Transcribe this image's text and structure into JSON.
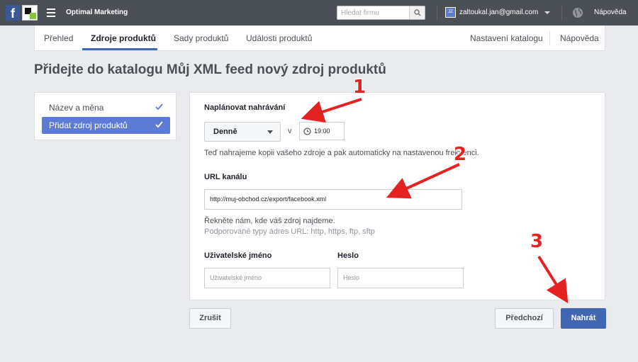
{
  "topbar": {
    "app_name": "Optimal Marketing",
    "search_placeholder": "Hledat firmu",
    "avatar_initials": "JZ",
    "user_email": "zaltoukal.jan@gmail.com",
    "help": "Nápověda"
  },
  "tabs": {
    "items": [
      {
        "label": "Přehled"
      },
      {
        "label": "Zdroje produktů"
      },
      {
        "label": "Sady produktů"
      },
      {
        "label": "Události produktů"
      }
    ],
    "active_index": 1,
    "right": [
      {
        "label": "Nastavení katalogu"
      },
      {
        "label": "Nápověda"
      }
    ]
  },
  "page": {
    "title": "Přidejte do katalogu Můj XML feed nový zdroj produktů"
  },
  "steps": [
    {
      "label": "Název a měna",
      "done": true
    },
    {
      "label": "Přidat zdroj produktů",
      "active": true
    }
  ],
  "form": {
    "schedule_label": "Naplánovat nahrávání",
    "frequency_value": "Denně",
    "at_label": "v",
    "time_value": "19:00",
    "schedule_help": "Teď nahrajeme kopii vašeho zdroje a pak automaticky na nastavenou frekvenci.",
    "url_label": "URL kanálu",
    "url_value": "http://muj-obchod.cz/export/facebook.xml",
    "url_help": "Řekněte nám, kde váš zdroj najdeme.",
    "url_supported": "Podporované typy adres URL: http, https, ftp, sftp",
    "username_label": "Uživatelské jméno",
    "username_placeholder": "Uživatelské jméno",
    "password_label": "Heslo",
    "password_placeholder": "Heslo"
  },
  "buttons": {
    "cancel": "Zrušit",
    "previous": "Předchozí",
    "upload": "Nahrát"
  },
  "annotations": [
    "1",
    "2",
    "3"
  ],
  "colors": {
    "topbar": "#4b4f56",
    "primary": "#4267b2",
    "step_active": "#5b7bd5",
    "annotation": "#e52222"
  }
}
